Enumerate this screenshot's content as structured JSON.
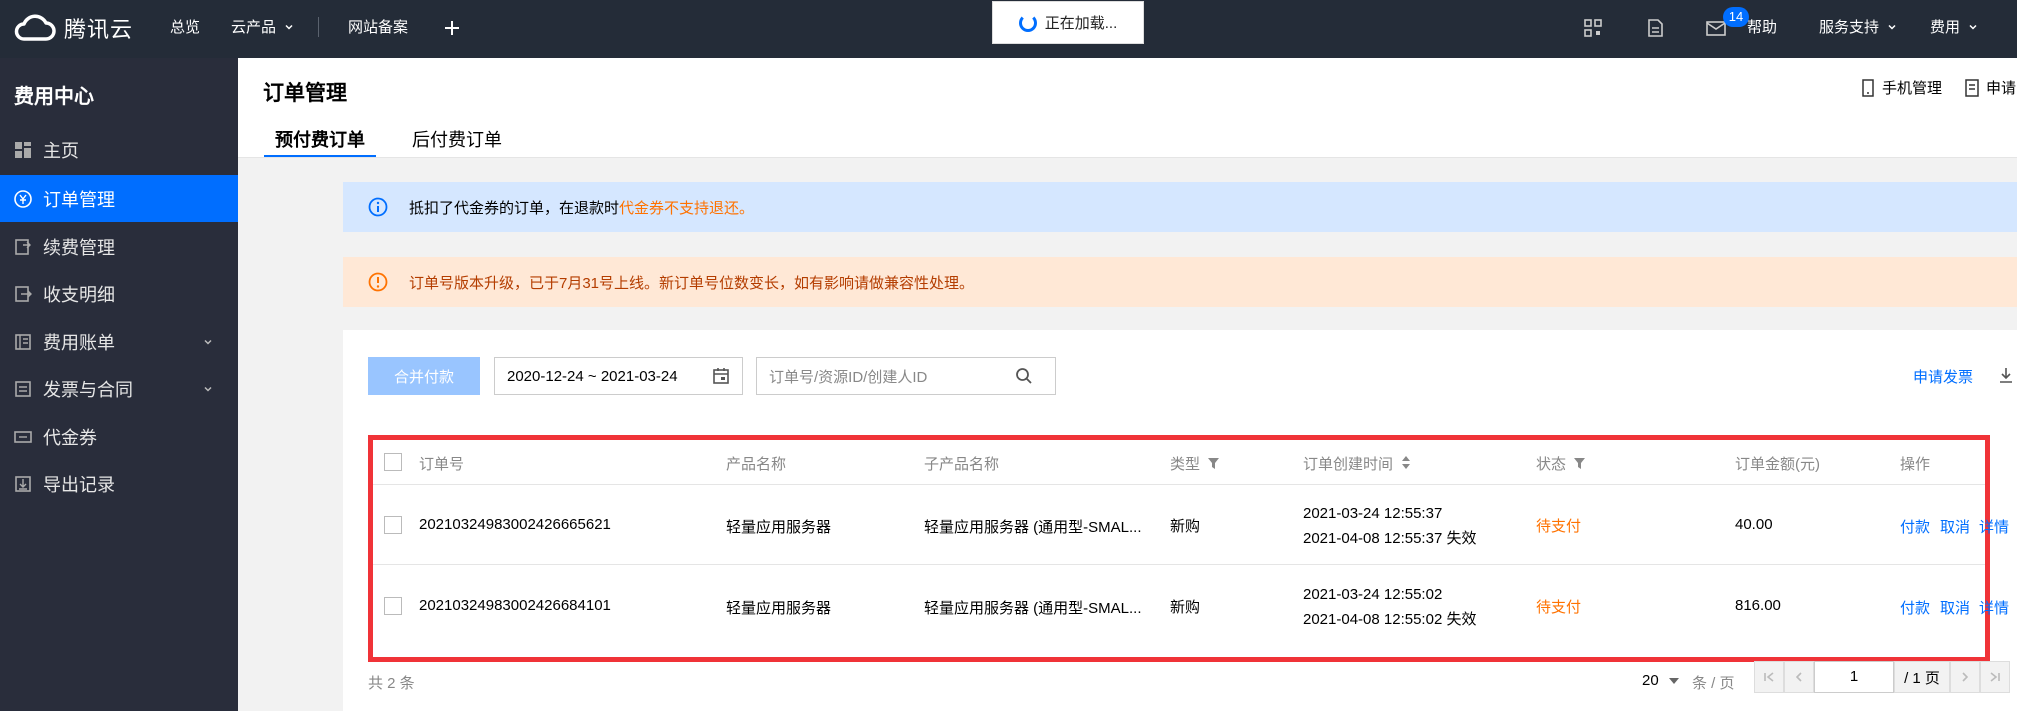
{
  "topbar": {
    "brand": "腾讯云",
    "nav": [
      "总览",
      "云产品",
      "网站备案"
    ],
    "loading_text": "正在加载...",
    "badge_count": "14",
    "help": "帮助",
    "service_support": "服务支持",
    "billing": "费用"
  },
  "sidebar": {
    "title": "费用中心",
    "items": [
      {
        "label": "主页",
        "icon": "grid-icon"
      },
      {
        "label": "订单管理",
        "icon": "yuan-icon"
      },
      {
        "label": "续费管理",
        "icon": "renew-icon"
      },
      {
        "label": "收支明细",
        "icon": "detail-icon"
      },
      {
        "label": "费用账单",
        "icon": "bill-icon"
      },
      {
        "label": "发票与合同",
        "icon": "invoice-icon"
      },
      {
        "label": "代金券",
        "icon": "voucher-icon"
      },
      {
        "label": "导出记录",
        "icon": "export-icon"
      }
    ]
  },
  "header": {
    "title": "订单管理",
    "mobile_mgmt": "手机管理",
    "apply": "申请",
    "tabs": [
      "预付费订单",
      "后付费订单"
    ]
  },
  "alerts": {
    "info_prefix": "抵扣了代金券的订单，在退款时",
    "info_highlight": "代金券不支持退还",
    "info_suffix": "。",
    "warn": "订单号版本升级，已于7月31号上线。新订单号位数变长，如有影响请做兼容性处理。"
  },
  "toolbar": {
    "merge_pay": "合并付款",
    "date_range": "2020-12-24 ~ 2021-03-24",
    "search_placeholder": "订单号/资源ID/创建人ID",
    "apply_invoice": "申请发票"
  },
  "table": {
    "columns": [
      "订单号",
      "产品名称",
      "子产品名称",
      "类型",
      "订单创建时间",
      "状态",
      "订单金额(元)",
      "操作"
    ],
    "rows": [
      {
        "order_id": "20210324983002426665621",
        "product": "轻量应用服务器",
        "sub_product": "轻量应用服务器 (通用型-SMAL...",
        "type": "新购",
        "created": "2021-03-24 12:55:37",
        "expires": "2021-04-08 12:55:37 失效",
        "status": "待支付",
        "amount": "40.00",
        "actions": [
          "付款",
          "取消",
          "详情"
        ]
      },
      {
        "order_id": "20210324983002426684101",
        "product": "轻量应用服务器",
        "sub_product": "轻量应用服务器 (通用型-SMAL...",
        "type": "新购",
        "created": "2021-03-24 12:55:02",
        "expires": "2021-04-08 12:55:02 失效",
        "status": "待支付",
        "amount": "816.00",
        "actions": [
          "付款",
          "取消",
          "详情"
        ]
      }
    ]
  },
  "footer": {
    "total": "共 2 条",
    "page_size": "20",
    "page_unit": "条 / 页",
    "current_page": "1",
    "total_pages": "/ 1 页"
  },
  "colors": {
    "topbar": "#242c38",
    "sidebar": "#292d3b",
    "accent": "#006eff",
    "warning": "#ff7200",
    "highlight_border": "#f03338"
  }
}
